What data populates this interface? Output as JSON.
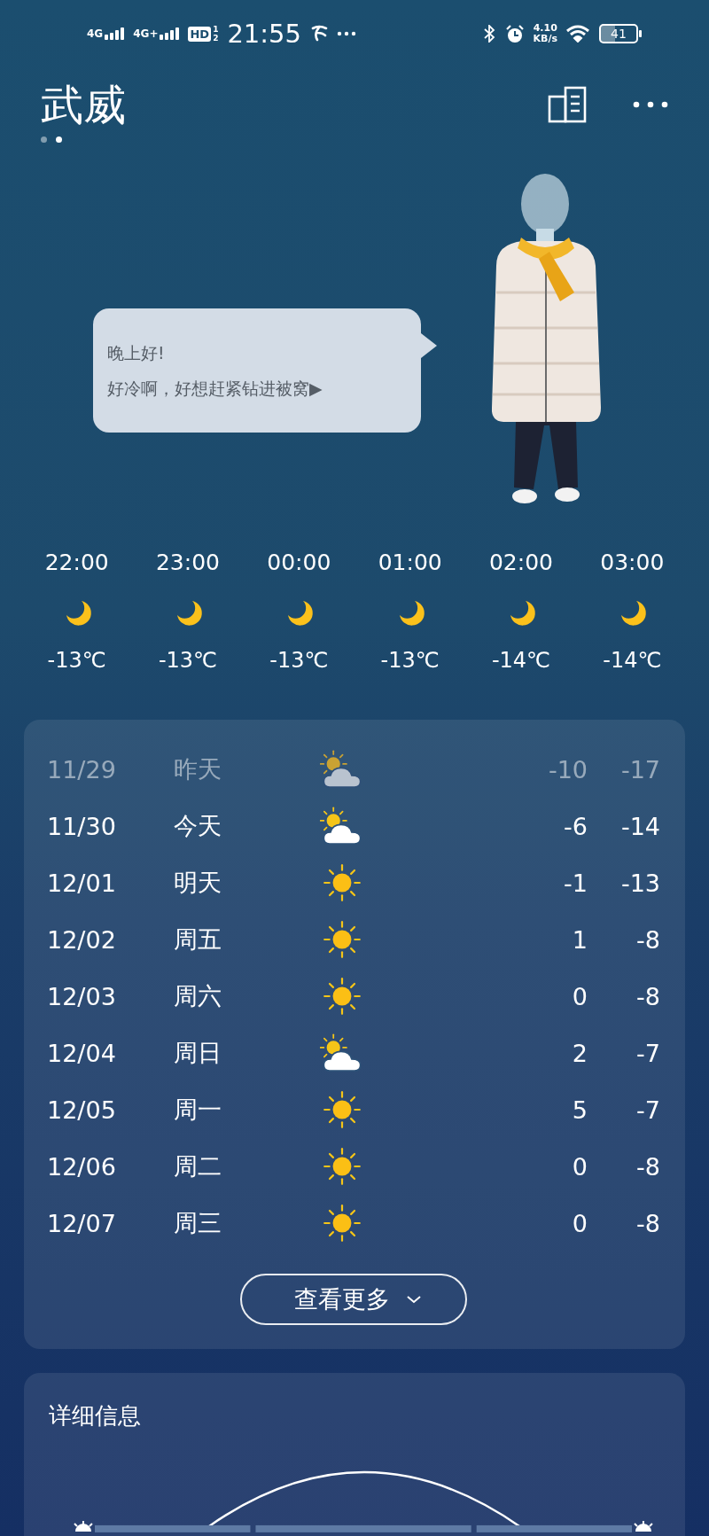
{
  "status_bar": {
    "networks": [
      "4G",
      "4G+"
    ],
    "hd": "HD",
    "sim_slots": [
      "1",
      "2"
    ],
    "time": "21:55",
    "speed": "4.10",
    "speed_unit": "KB/s",
    "battery": "41"
  },
  "header": {
    "city": "武威",
    "pages": [
      {
        "selected": false
      },
      {
        "selected": true
      }
    ]
  },
  "speech_bubble": {
    "lines": [
      "晚上好!",
      "好冷啊，好想赶紧钻进被窝▶"
    ]
  },
  "hourly": [
    {
      "time": "22:00",
      "temp": "-13℃"
    },
    {
      "time": "23:00",
      "temp": "-13℃"
    },
    {
      "time": "00:00",
      "temp": "-13℃"
    },
    {
      "time": "01:00",
      "temp": "-13℃"
    },
    {
      "time": "02:00",
      "temp": "-14℃"
    },
    {
      "time": "03:00",
      "temp": "-14℃"
    }
  ],
  "daily": [
    {
      "date": "11/29",
      "day": "昨天",
      "kind": "partly_cloudy",
      "high": "-10",
      "low": "-17",
      "past": true
    },
    {
      "date": "11/30",
      "day": "今天",
      "kind": "partly_cloudy",
      "high": "-6",
      "low": "-14",
      "past": false
    },
    {
      "date": "12/01",
      "day": "明天",
      "kind": "sunny",
      "high": "-1",
      "low": "-13",
      "past": false
    },
    {
      "date": "12/02",
      "day": "周五",
      "kind": "sunny",
      "high": "1",
      "low": "-8",
      "past": false
    },
    {
      "date": "12/03",
      "day": "周六",
      "kind": "sunny",
      "high": "0",
      "low": "-8",
      "past": false
    },
    {
      "date": "12/04",
      "day": "周日",
      "kind": "partly_cloudy",
      "high": "2",
      "low": "-7",
      "past": false
    },
    {
      "date": "12/05",
      "day": "周一",
      "kind": "sunny",
      "high": "5",
      "low": "-7",
      "past": false
    },
    {
      "date": "12/06",
      "day": "周二",
      "kind": "sunny",
      "high": "0",
      "low": "-8",
      "past": false
    },
    {
      "date": "12/07",
      "day": "周三",
      "kind": "sunny",
      "high": "0",
      "low": "-8",
      "past": false
    }
  ],
  "more_button": "查看更多",
  "details": {
    "title": "详细信息"
  }
}
